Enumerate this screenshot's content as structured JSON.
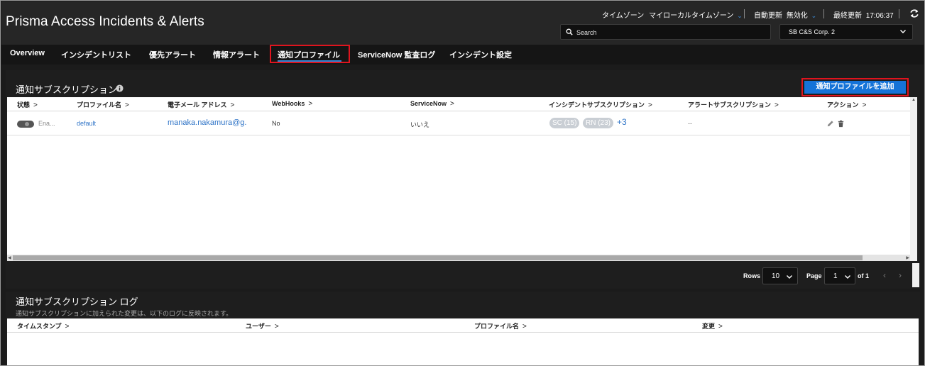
{
  "header": {
    "title": "Prisma Access Incidents & Alerts",
    "timezone_label": "タイムゾーン",
    "timezone_value": "マイローカルタイムゾーン",
    "auto_refresh_label": "自動更新",
    "auto_refresh_value": "無効化",
    "last_update_label": "最終更新",
    "last_update_time": "17:06:37",
    "search_placeholder": "Search",
    "tenant": "SB C&S Corp. 2"
  },
  "nav": {
    "tabs": [
      {
        "label": "Overview"
      },
      {
        "label": "インシデントリスト"
      },
      {
        "label": "優先アラート"
      },
      {
        "label": "情報アラート"
      },
      {
        "label": "通知プロファイル",
        "active": true
      },
      {
        "label": "ServiceNow 監査ログ"
      },
      {
        "label": "インシデント設定"
      }
    ]
  },
  "subscriptions": {
    "title": "通知サブスクリプション",
    "add_button": "通知プロファイルを追加",
    "columns": [
      "状態",
      "プロファイル名",
      "電子メール アドレス",
      "WebHooks",
      "ServiceNow",
      "インシデントサブスクリプション",
      "アラートサブスクリプション",
      "アクション"
    ],
    "rows": [
      {
        "status": "Ena...",
        "profile_name": "default",
        "email": "manaka.nakamura@g.",
        "webhooks": "No",
        "servicenow": "いいえ",
        "incident_pills": [
          "SC (15)",
          "RN (23)"
        ],
        "incident_more": "+3",
        "alert_subscription": "--"
      }
    ],
    "pager": {
      "rows_label": "Rows",
      "rows_value": "10",
      "page_label": "Page",
      "page_value": "1",
      "of_label": "of 1"
    }
  },
  "log": {
    "title": "通知サブスクリプション ログ",
    "description": "通知サブスクリプションに加えられた変更は、以下のログに反映されます。",
    "columns": [
      "タイムスタンプ",
      "ユーザー",
      "プロファイル名",
      "変更"
    ]
  },
  "colors": {
    "accent": "#1573d8",
    "highlight": "#e0141e",
    "link": "#2f74c7",
    "header_bg": "#262626"
  }
}
